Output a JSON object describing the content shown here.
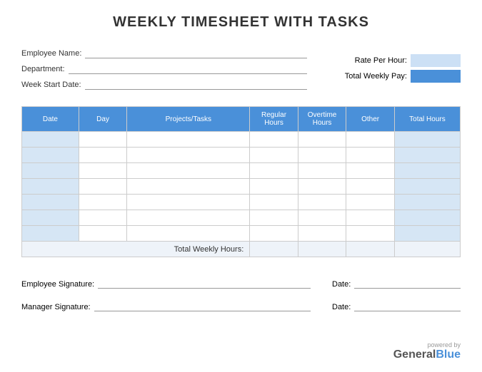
{
  "title": "WEEKLY TIMESHEET WITH TASKS",
  "fields": {
    "employee_name": "Employee Name:",
    "department": "Department:",
    "week_start": "Week Start Date:",
    "rate_per_hour": "Rate Per Hour:",
    "total_weekly_pay": "Total Weekly Pay:"
  },
  "table": {
    "headers": {
      "date": "Date",
      "day": "Day",
      "tasks": "Projects/Tasks",
      "regular": "Regular Hours",
      "overtime": "Overtime Hours",
      "other": "Other",
      "total": "Total Hours"
    },
    "total_label": "Total Weekly Hours:"
  },
  "signatures": {
    "employee": "Employee Signature:",
    "manager": "Manager Signature:",
    "date": "Date:"
  },
  "footer": {
    "powered": "powered by",
    "brand_first": "General",
    "brand_second": "Blue"
  }
}
